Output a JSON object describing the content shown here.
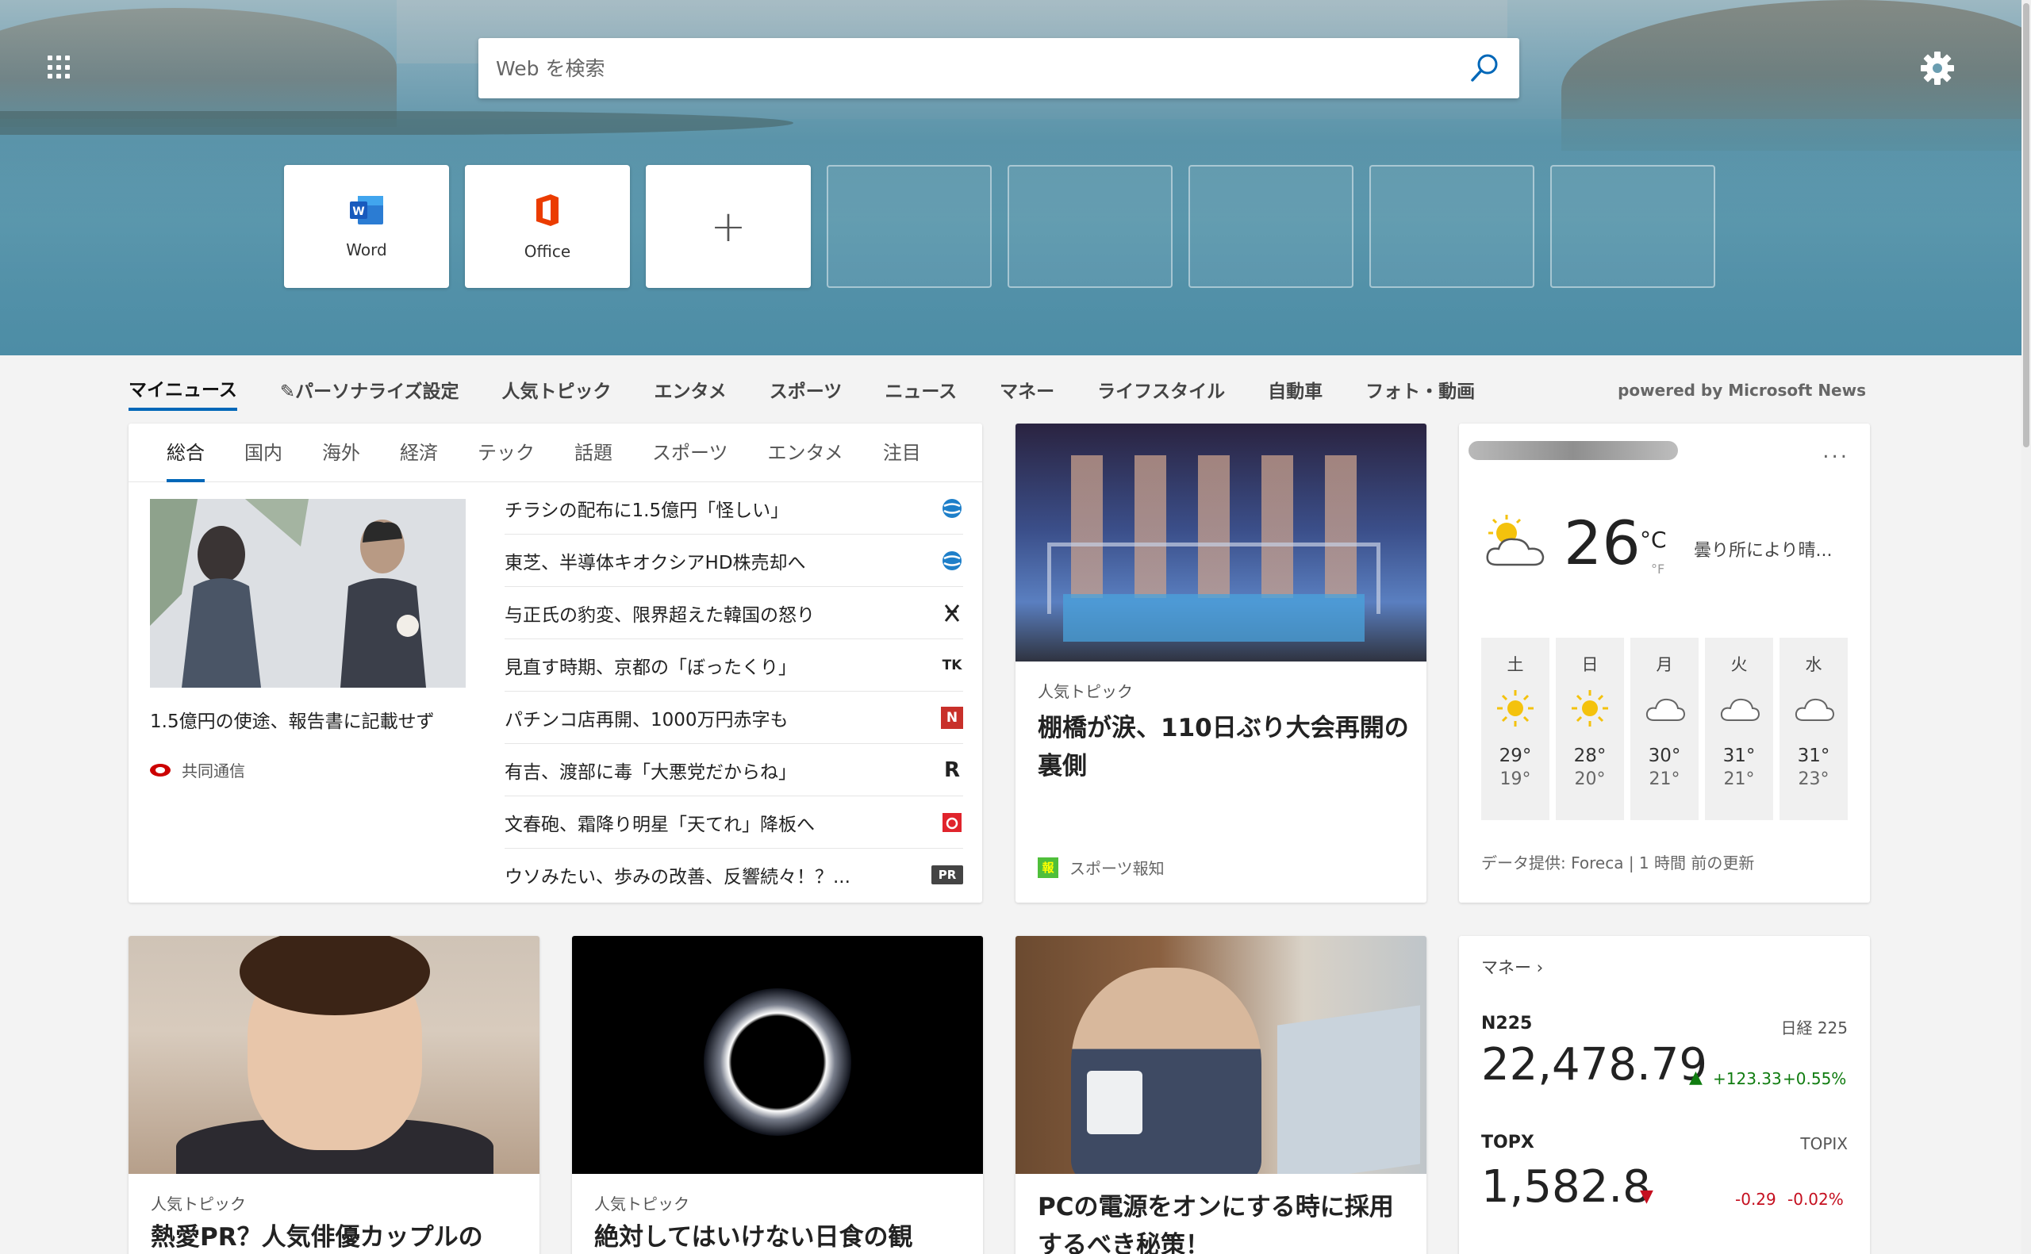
{
  "search": {
    "placeholder": "Web を検索"
  },
  "tiles": [
    {
      "label": "Word"
    },
    {
      "label": "Office"
    },
    {
      "label": "+"
    }
  ],
  "nav": {
    "items": [
      "マイニュース",
      "パーソナライズ設定",
      "人気トピック",
      "エンタメ",
      "スポーツ",
      "ニュース",
      "マネー",
      "ライフスタイル",
      "自動車",
      "フォト・動画"
    ],
    "powered": "powered by Microsoft News"
  },
  "main": {
    "subtabs": [
      "総合",
      "国内",
      "海外",
      "経済",
      "テック",
      "話題",
      "スポーツ",
      "エンタメ",
      "注目"
    ],
    "headline": {
      "title": "1.5億円の使途、報告書に記載せず",
      "source": "共同通信"
    },
    "list": [
      {
        "title": "チラシの配布に1.5億円「怪しい」",
        "logo": "globe-logo"
      },
      {
        "title": "東芝、半導体キオクシアHD株売却へ",
        "logo": "globe-logo"
      },
      {
        "title": "与正氏の豹変、限界超えた韓国の怒り",
        "logo": "cross-logo"
      },
      {
        "title": "見直す時期、京都の「ぼったくり」",
        "logo": "TK"
      },
      {
        "title": "パチンコ店再開、1000万円赤字も",
        "logo": "N"
      },
      {
        "title": "有吉、渡部に毒「大悪党だからね」",
        "logo": "R"
      },
      {
        "title": "文春砲、霜降り明星「天てれ」降板へ",
        "logo": "bunshun-logo"
      },
      {
        "title": "ウソみたい、歩みの改善、反響続々！？...",
        "logo": "PR"
      }
    ]
  },
  "feature": {
    "tag": "人気トピック",
    "title": "棚橋が涙、110日ぶり大会再開の裏側",
    "source": "スポーツ報知",
    "source_icon": "報"
  },
  "weather": {
    "temp": "26",
    "unit_c": "°C",
    "unit_f": "°F",
    "desc": "曇り所により晴...",
    "more": "...",
    "forecast": [
      {
        "day": "土",
        "icon": "sun",
        "hi": "29°",
        "lo": "19°"
      },
      {
        "day": "日",
        "icon": "sun",
        "hi": "28°",
        "lo": "20°"
      },
      {
        "day": "月",
        "icon": "cloud",
        "hi": "30°",
        "lo": "21°"
      },
      {
        "day": "火",
        "icon": "cloud",
        "hi": "31°",
        "lo": "21°"
      },
      {
        "day": "水",
        "icon": "cloud",
        "hi": "31°",
        "lo": "23°"
      }
    ],
    "source": "データ提供: Foreca | 1 時間 前の更新"
  },
  "bottom": [
    {
      "tag": "人気トピック",
      "title": "熱愛PR？人気俳優カップルの"
    },
    {
      "tag": "人気トピック",
      "title": "絶対してはいけない日食の観"
    },
    {
      "tag": "",
      "title": "PCの電源をオンにする時に採用するべき秘策！"
    }
  ],
  "money": {
    "header": "マネー",
    "indices": [
      {
        "name": "N225",
        "label": "日経 225",
        "value": "22,478.79",
        "dir": "up",
        "arrow": "▲",
        "change": "+123.33",
        "pct": "+0.55%"
      },
      {
        "name": "TOPX",
        "label": "TOPIX",
        "value": "1,582.8",
        "dir": "down",
        "arrow": "▼",
        "change": "-0.29",
        "pct": "-0.02%"
      }
    ]
  },
  "colors": {
    "accent": "#0067b8",
    "up": "#107c10",
    "down": "#c50f1f"
  }
}
